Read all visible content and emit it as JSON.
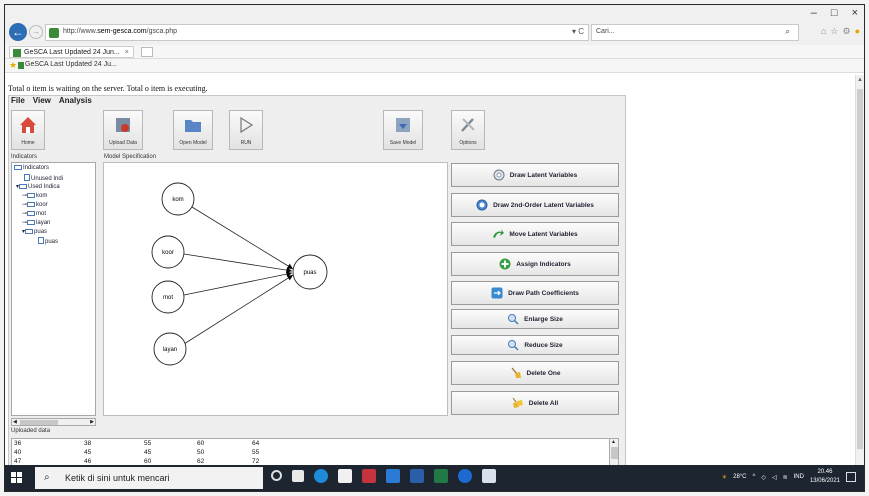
{
  "browser": {
    "url_prefix": "http://www.",
    "url_domain": "sem-gesca.com",
    "url_path": "/gsca.php",
    "addr_tools": "▾ C",
    "search_text": "Cari...",
    "tab_title": "GeSCA Last Updated 24 Jun...",
    "favorite_title": "GeSCA Last Updated 24 Ju..."
  },
  "page": {
    "status_text": "Total o item is waiting on the server. Total o item is executing."
  },
  "applet": {
    "menu": [
      "File",
      "View",
      "Analysis"
    ],
    "toolbar": {
      "home": "Home",
      "upload_data": "Upload Data",
      "open_model": "Open Model",
      "run": "RUN",
      "save_model": "Save Model",
      "options": "Options"
    },
    "indicators_label": "Indicators",
    "model_label": "Model Specification",
    "tree": {
      "root": "Indicators",
      "unused": "Unused Indi",
      "used": "Used Indica",
      "items": [
        "kom",
        "koor",
        "mot",
        "layan",
        "puas"
      ],
      "leaf": "puas"
    },
    "model": {
      "nodes": [
        "kom",
        "koor",
        "mot",
        "layan"
      ],
      "target": "puas"
    },
    "side_buttons": [
      {
        "label": "Draw Latent Variables",
        "icon": "ellipse-icon"
      },
      {
        "label": "Draw 2nd-Order Latent Variables",
        "icon": "ellipse-icon"
      },
      {
        "label": "Move Latent Variables",
        "icon": "move-arrow-icon"
      },
      {
        "label": "Assign Indicators",
        "icon": "plus-icon"
      },
      {
        "label": "Draw Path Coefficients",
        "icon": "path-icon"
      },
      {
        "label": "Enlarge Size",
        "icon": "zoom-in-icon"
      },
      {
        "label": "Reduce Size",
        "icon": "zoom-out-icon"
      },
      {
        "label": "Delete One",
        "icon": "broom-icon"
      },
      {
        "label": "Delete All",
        "icon": "brooms-icon"
      }
    ],
    "uploaded_label": "Uploaded data",
    "data_rows": [
      [
        "36",
        "38",
        "55",
        "60",
        "64"
      ],
      [
        "40",
        "45",
        "45",
        "50",
        "55"
      ],
      [
        "47",
        "46",
        "60",
        "62",
        "72"
      ]
    ]
  },
  "taskbar": {
    "search_placeholder": "Ketik di sini untuk mencari",
    "temperature": "28°C",
    "lang": "IND",
    "time": "20.46",
    "date": "13/06/2021"
  }
}
